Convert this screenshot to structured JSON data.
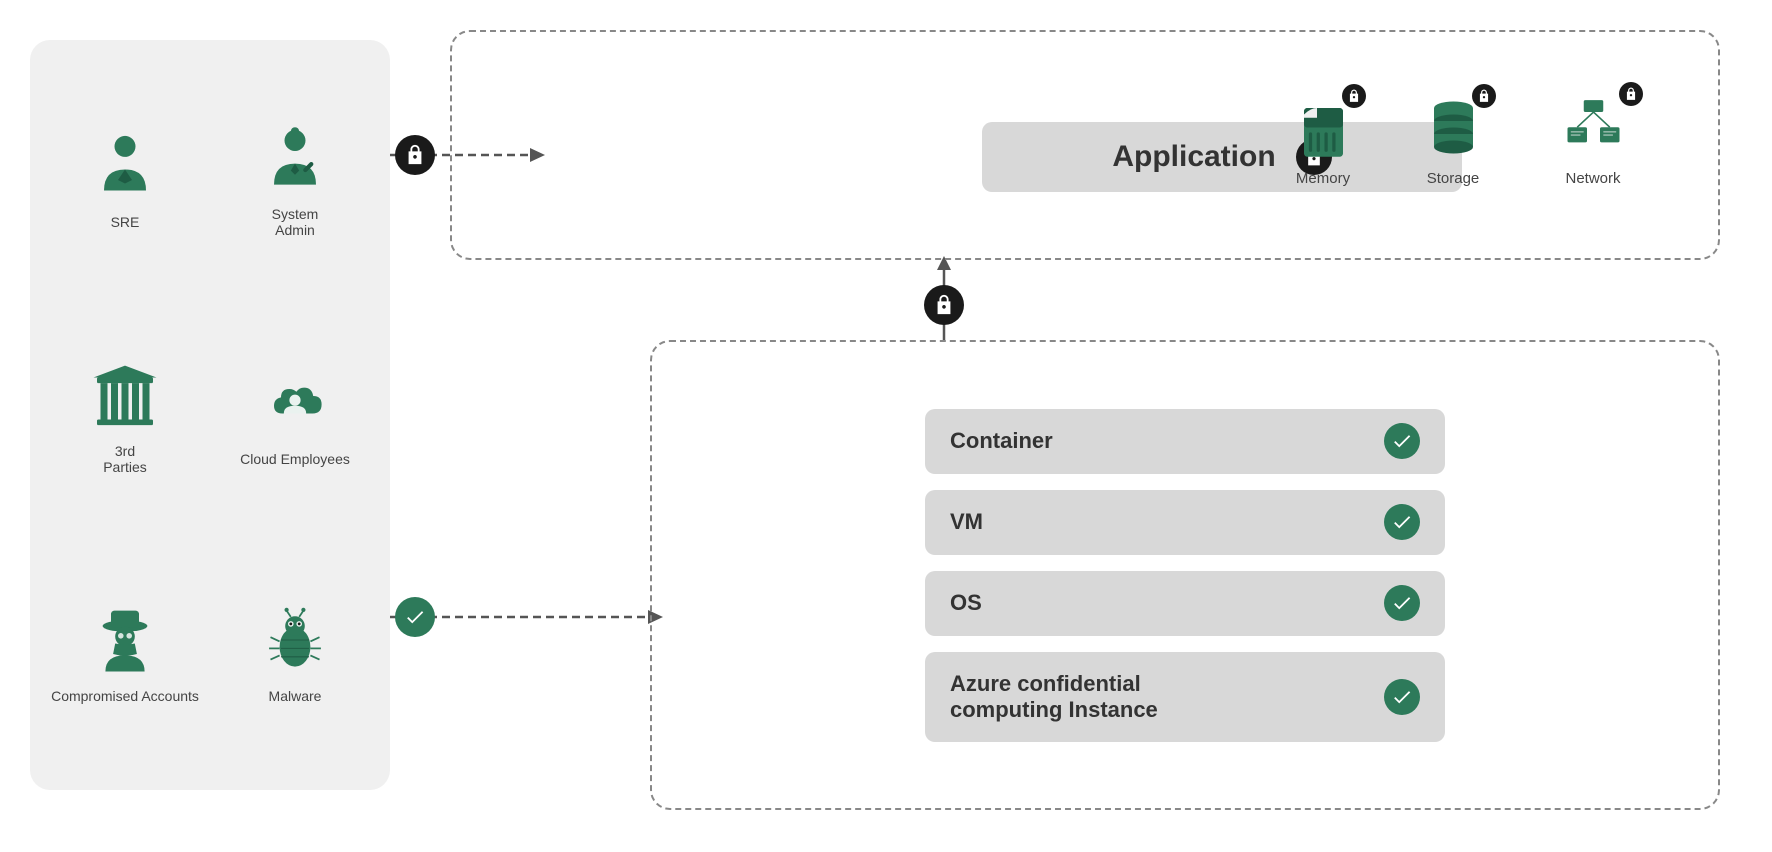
{
  "actors": [
    {
      "id": "sre",
      "label": "SRE",
      "icon": "person"
    },
    {
      "id": "sysadmin",
      "label": "System\nAdmin",
      "icon": "person-admin"
    },
    {
      "id": "third-parties",
      "label": "3rd\nParties",
      "icon": "building"
    },
    {
      "id": "cloud-employees",
      "label": "Cloud\nEmployees",
      "icon": "cloud-person"
    },
    {
      "id": "compromised-accounts",
      "label": "Compromised\nAccounts",
      "icon": "spy"
    },
    {
      "id": "malware",
      "label": "Malware",
      "icon": "bug"
    }
  ],
  "application": {
    "label": "Application"
  },
  "resources": [
    {
      "id": "memory",
      "label": "Memory",
      "icon": "memory"
    },
    {
      "id": "storage",
      "label": "Storage",
      "icon": "database"
    },
    {
      "id": "network",
      "label": "Network",
      "icon": "network"
    }
  ],
  "infra_rows": [
    {
      "id": "container",
      "label": "Container"
    },
    {
      "id": "vm",
      "label": "VM"
    },
    {
      "id": "os",
      "label": "OS"
    },
    {
      "id": "azure",
      "label": "Azure confidential\ncomputing Instance"
    }
  ],
  "colors": {
    "green": "#2d7a5a",
    "dark": "#1a1a1a",
    "panel_bg": "#f0f0f0",
    "bar_bg": "#d8d8d8",
    "border_dash": "#888888"
  }
}
